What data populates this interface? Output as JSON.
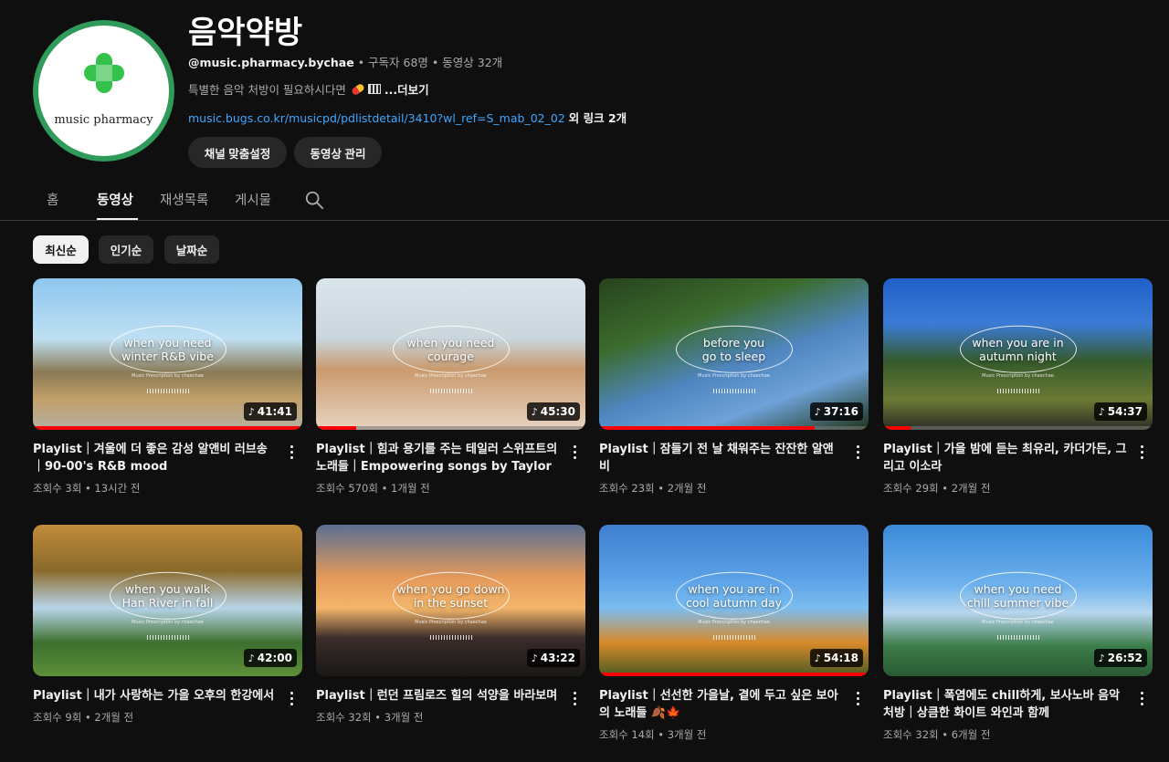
{
  "channel": {
    "avatar_text": "music pharmacy",
    "name": "음악약방",
    "handle": "@music.pharmacy.bychae",
    "subscribers": "구독자 68명",
    "video_count": "동영상 32개",
    "description": "특별한 음악 처방이 필요하시다면",
    "more_label": "...더보기",
    "link_url": "music.bugs.co.kr/musicpd/pdlistdetail/3410?wl_ref=S_mab_02_02",
    "link_extra": "외 링크 2개",
    "customize_button": "채널 맞춤설정",
    "manage_button": "동영상 관리"
  },
  "tabs": [
    "홈",
    "동영상",
    "재생목록",
    "게시물"
  ],
  "active_tab": "동영상",
  "chips": [
    "최신순",
    "인기순",
    "날짜순"
  ],
  "active_chip": "최신순",
  "videos": [
    {
      "title": "Playlist｜겨울에 더 좋은 감성 알앤비 러브송｜90-00's R&B mood",
      "views": "조회수 3회",
      "age": "13시간 전",
      "duration": "41:41",
      "overlay": "when you need\nwinter R&B vibe",
      "progress": 1.0
    },
    {
      "title": "Playlist｜힘과 용기를 주는 테일러 스위프트의 노래들｜Empowering songs by Taylor Swift",
      "views": "조회수 570회",
      "age": "1개월 전",
      "duration": "45:30",
      "overlay": "when you need\ncourage",
      "progress": 0.15
    },
    {
      "title": "Playlist｜잠들기 전 날 채워주는 잔잔한 알앤비",
      "views": "조회수 23회",
      "age": "2개월 전",
      "duration": "37:16",
      "overlay": "before you\ngo to sleep",
      "progress": 0.8
    },
    {
      "title": "Playlist｜가을 밤에 듣는 최유리, 카더가든, 그리고 이소라",
      "views": "조회수 29회",
      "age": "2개월 전",
      "duration": "54:37",
      "overlay": "when you are in\nautumn night",
      "progress": 0.1
    },
    {
      "title": "Playlist｜내가 사랑하는 가을 오후의 한강에서",
      "views": "조회수 9회",
      "age": "2개월 전",
      "duration": "42:00",
      "overlay": "when you walk\nHan River in fall",
      "progress": 0.0
    },
    {
      "title": "Playlist｜런던 프림로즈 힐의 석양을 바라보며",
      "views": "조회수 32회",
      "age": "3개월 전",
      "duration": "43:22",
      "overlay": "when you go down\nin the sunset",
      "progress": 0.0
    },
    {
      "title": "Playlist｜선선한 가을날, 곁에 두고 싶은 보아의 노래들 🍂🍁",
      "views": "조회수 14회",
      "age": "3개월 전",
      "duration": "54:18",
      "overlay": "when you are in\ncool autumn day",
      "progress": 1.0
    },
    {
      "title": "Playlist｜폭염에도 chill하게, 보사노바 음악 처방｜상큼한 화이트 와인과 함께",
      "views": "조회수 32회",
      "age": "6개월 전",
      "duration": "26:52",
      "overlay": "when you need\nchill summer vibe",
      "progress": 0.0
    }
  ],
  "overlay_subtitle": "Music Prescription by chaechae",
  "colors": {
    "background": "#0f0f0f",
    "chip_bg": "#272727",
    "link": "#3ea6ff",
    "progress": "#ff0000",
    "avatar_ring": "#2f9a5a",
    "cross": "#34c24a"
  }
}
